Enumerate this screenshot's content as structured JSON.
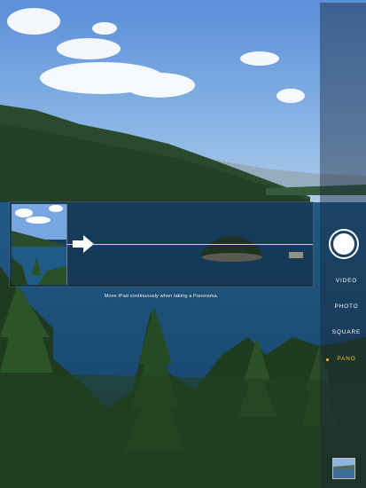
{
  "panorama": {
    "instruction": "Move iPad continuously when taking a Panorama."
  },
  "controls": {
    "modes": [
      {
        "label": "VIDEO",
        "selected": false
      },
      {
        "label": "PHOTO",
        "selected": false
      },
      {
        "label": "SQUARE",
        "selected": false
      },
      {
        "label": "PANO",
        "selected": true
      }
    ],
    "shutter_icon": "shutter-circle",
    "selected_color": "#f5c518",
    "guide_line_color": "#e7d66a"
  }
}
